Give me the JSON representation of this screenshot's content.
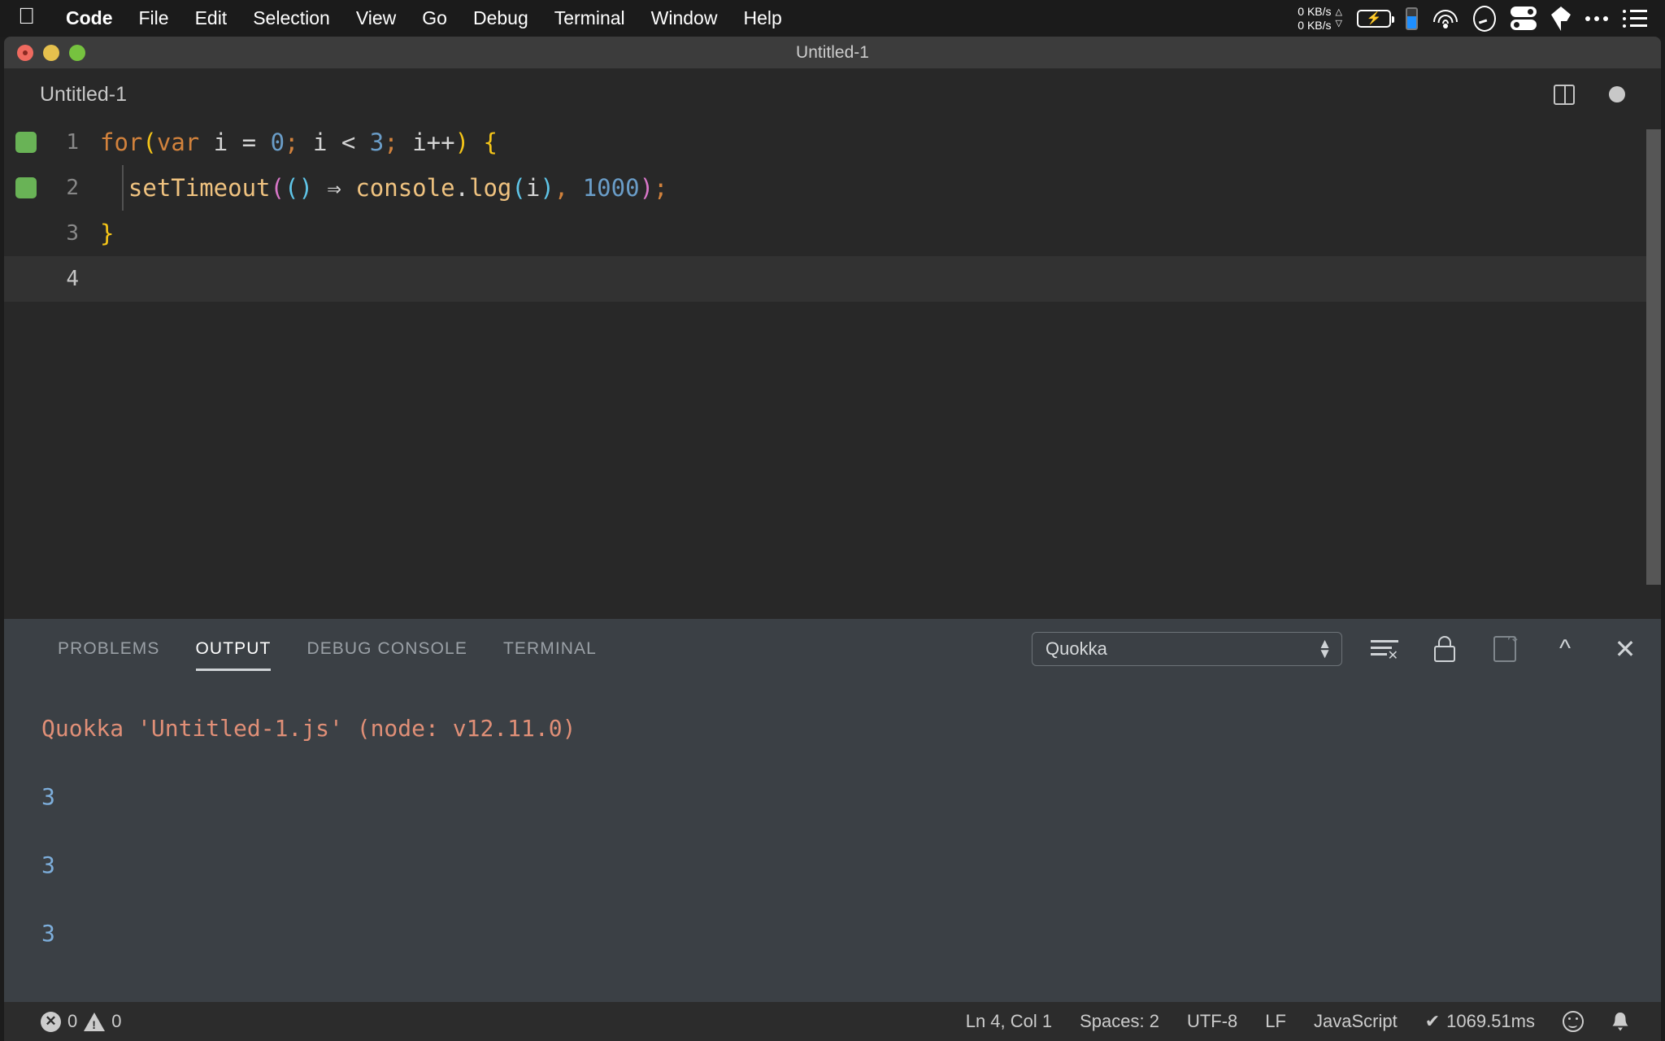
{
  "macmenu": {
    "apple_icon": "apple-logo-icon",
    "items": [
      {
        "label": "Code",
        "bold": true
      },
      {
        "label": "File",
        "bold": false
      },
      {
        "label": "Edit",
        "bold": false
      },
      {
        "label": "Selection",
        "bold": false
      },
      {
        "label": "View",
        "bold": false
      },
      {
        "label": "Go",
        "bold": false
      },
      {
        "label": "Debug",
        "bold": false
      },
      {
        "label": "Terminal",
        "bold": false
      },
      {
        "label": "Window",
        "bold": false
      },
      {
        "label": "Help",
        "bold": false
      }
    ],
    "status": {
      "net_up": "0 KB/s",
      "net_down": "0 KB/s",
      "up_arrow": "△",
      "down_arrow": "▽",
      "battery_icon": "battery-charging-icon",
      "battery_bolt": "⚡",
      "indicator_icon": "blue-level-indicator-icon",
      "wifi_icon": "wifi-icon",
      "gauge_icon": "gauge-icon",
      "toggles_icon": "toggles-icon",
      "kite_icon": "kite-app-icon",
      "dots_icon": "more-dots-icon",
      "list_icon": "control-center-list-icon"
    }
  },
  "window": {
    "title": "Untitled-1",
    "traffic": {
      "close": "close-window",
      "minimize": "minimize-window",
      "zoom": "zoom-window"
    }
  },
  "editor_header": {
    "filename": "Untitled-1",
    "split_icon": "split-editor-icon",
    "dirty_dot": "unsaved-changes-dot"
  },
  "editor": {
    "active_line": 4,
    "lines": [
      {
        "number": "1",
        "marked": true,
        "indent_guide": false,
        "tokens": [
          {
            "t": "for",
            "c": "t-key"
          },
          {
            "t": "(",
            "c": "t-paren-y"
          },
          {
            "t": "var",
            "c": "t-var"
          },
          {
            "t": " i ",
            "c": "t-ident"
          },
          {
            "t": "= ",
            "c": "t-op"
          },
          {
            "t": "0",
            "c": "t-num"
          },
          {
            "t": "; ",
            "c": "t-punct"
          },
          {
            "t": "i ",
            "c": "t-ident"
          },
          {
            "t": "< ",
            "c": "t-op"
          },
          {
            "t": "3",
            "c": "t-num"
          },
          {
            "t": "; ",
            "c": "t-punct"
          },
          {
            "t": "i++",
            "c": "t-ident"
          },
          {
            "t": ")",
            "c": "t-paren-y"
          },
          {
            "t": " ",
            "c": "t-op"
          },
          {
            "t": "{",
            "c": "t-brace"
          }
        ]
      },
      {
        "number": "2",
        "marked": true,
        "indent_guide": true,
        "tokens": [
          {
            "t": "  ",
            "c": "t-op"
          },
          {
            "t": "setTimeout",
            "c": "t-fn"
          },
          {
            "t": "(",
            "c": "t-paren-m"
          },
          {
            "t": "()",
            "c": "t-paren-b"
          },
          {
            "t": " ⇒ ",
            "c": "t-arrow"
          },
          {
            "t": "console",
            "c": "t-fn"
          },
          {
            "t": ".",
            "c": "t-ident"
          },
          {
            "t": "log",
            "c": "t-fn"
          },
          {
            "t": "(",
            "c": "t-paren-b"
          },
          {
            "t": "i",
            "c": "t-ident"
          },
          {
            "t": ")",
            "c": "t-paren-b"
          },
          {
            "t": ", ",
            "c": "t-punct"
          },
          {
            "t": "1000",
            "c": "t-num"
          },
          {
            "t": ")",
            "c": "t-paren-m"
          },
          {
            "t": ";",
            "c": "t-punct"
          }
        ]
      },
      {
        "number": "3",
        "marked": false,
        "indent_guide": false,
        "tokens": [
          {
            "t": "}",
            "c": "t-brace"
          }
        ]
      },
      {
        "number": "4",
        "marked": false,
        "indent_guide": false,
        "tokens": []
      }
    ],
    "scrollbar": "editor-vertical-scrollbar"
  },
  "panel": {
    "tabs": [
      {
        "label": "PROBLEMS",
        "active": false
      },
      {
        "label": "OUTPUT",
        "active": true
      },
      {
        "label": "DEBUG CONSOLE",
        "active": false
      },
      {
        "label": "TERMINAL",
        "active": false
      }
    ],
    "channel_select": {
      "value": "Quokka",
      "options": [
        "Quokka"
      ]
    },
    "tools": {
      "clear_icon": "clear-output-icon",
      "lock_icon": "lock-scroll-icon",
      "new_editor_icon": "open-in-editor-icon",
      "maximize_icon": "maximize-panel-chevron-icon",
      "close_icon": "close-panel-icon"
    },
    "output": {
      "header": "Quokka 'Untitled-1.js' (node: v12.11.0)",
      "values": [
        "3",
        "3",
        "3"
      ]
    }
  },
  "statusbar": {
    "errors_icon": "error-circle-icon",
    "errors_count": "0",
    "warnings_icon": "warning-triangle-icon",
    "warnings_count": "0",
    "cursor_position": "Ln 4, Col 1",
    "indentation": "Spaces: 2",
    "encoding": "UTF-8",
    "eol": "LF",
    "language": "JavaScript",
    "run_check": "✔",
    "run_time": "1069.51ms",
    "feedback_icon": "smiley-feedback-icon",
    "bell_icon": "notifications-bell-icon",
    "bell_glyph": "🔔"
  },
  "colors": {
    "menubar_bg": "#1b1b1b",
    "titlebar_bg": "#3c3c3c",
    "editor_bg": "#282828",
    "panel_bg": "#3b4045",
    "statusbar_bg": "#2c2c2c",
    "marker_green": "#69b356",
    "output_value_blue": "#7daedb",
    "output_header_salmon": "#e08f77",
    "keyword_orange": "#d2823c",
    "number_blue": "#6a9dc8",
    "function_tan": "#f0c380",
    "brace_yellow": "#f5c518"
  }
}
